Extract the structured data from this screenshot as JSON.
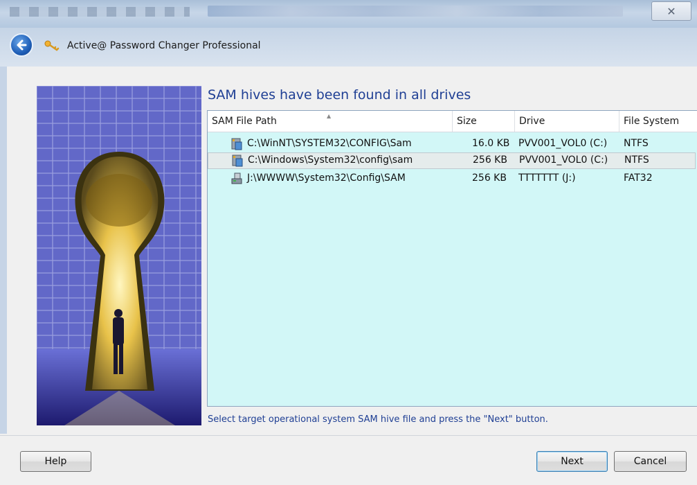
{
  "window": {
    "title": "Active@ Password Changer Professional",
    "close_glyph": "✕"
  },
  "main": {
    "heading": "SAM hives have been found in all drives",
    "columns": [
      "SAM File Path",
      "Size",
      "Drive",
      "File System"
    ],
    "rows": [
      {
        "path": "C:\\WinNT\\SYSTEM32\\CONFIG\\Sam",
        "size": "16.0 KB",
        "drive": "PVV001_VOL0 (C:)",
        "fs": "NTFS",
        "icon": "drive-icon",
        "selected": false
      },
      {
        "path": "C:\\Windows\\System32\\config\\sam",
        "size": "256 KB",
        "drive": "PVV001_VOL0 (C:)",
        "fs": "NTFS",
        "icon": "drive-icon",
        "selected": true
      },
      {
        "path": "J:\\WWWW\\System32\\Config\\SAM",
        "size": "256 KB",
        "drive": "TTTTTTT (J:)",
        "fs": "FAT32",
        "icon": "usb-drive-icon",
        "selected": false
      }
    ],
    "hint": "Select target operational system SAM hive file and press the \"Next\" button."
  },
  "buttons": {
    "help": "Help",
    "next": "Next",
    "cancel": "Cancel"
  },
  "colors": {
    "list_background": "#d2f7f7",
    "heading_blue": "#1f3f94"
  }
}
